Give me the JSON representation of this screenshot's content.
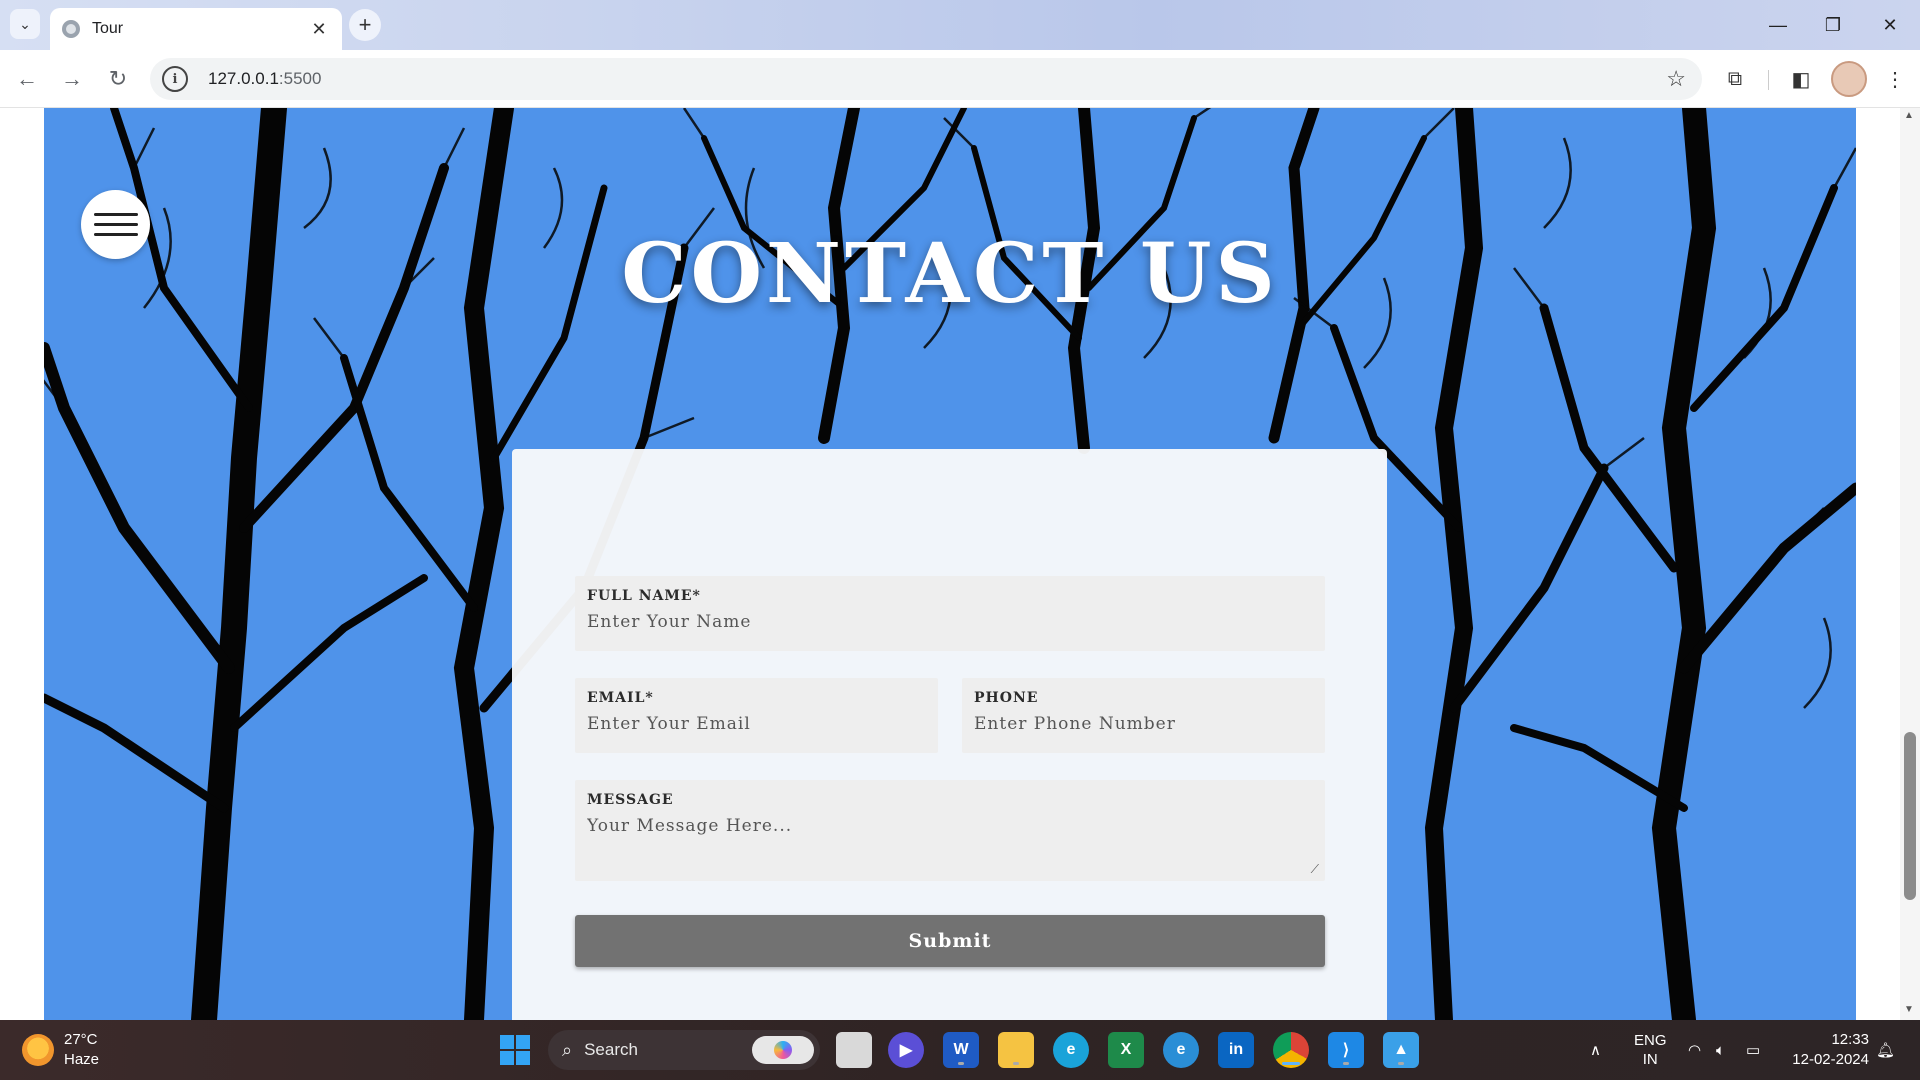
{
  "browser": {
    "tab_title": "Tour",
    "url_host": "127.0.0.1",
    "url_port": ":5500",
    "accent": "#5fb3f9"
  },
  "page": {
    "title": "CONTACT US",
    "hero_color": "#4f93ea",
    "form": {
      "full_name": {
        "label": "FULL NAME*",
        "placeholder": "Enter Your Name"
      },
      "email": {
        "label": "EMAIL*",
        "placeholder": "Enter Your Email"
      },
      "phone": {
        "label": "PHONE",
        "placeholder": "Enter Phone Number"
      },
      "message": {
        "label": "MESSAGE",
        "placeholder": "Your Message Here..."
      },
      "submit_label": "Submit"
    }
  },
  "taskbar": {
    "weather": {
      "temp": "27°C",
      "desc": "Haze"
    },
    "search_label": "Search",
    "apps": [
      "file-explorer-icon",
      "meet-icon",
      "word-icon",
      "folder-icon",
      "edge-icon",
      "excel-icon",
      "edge-beta-icon",
      "linkedin-icon",
      "chrome-icon",
      "vscode-icon",
      "photos-icon"
    ],
    "lang_line1": "ENG",
    "lang_line2": "IN",
    "time": "12:33",
    "date": "12-02-2024"
  }
}
